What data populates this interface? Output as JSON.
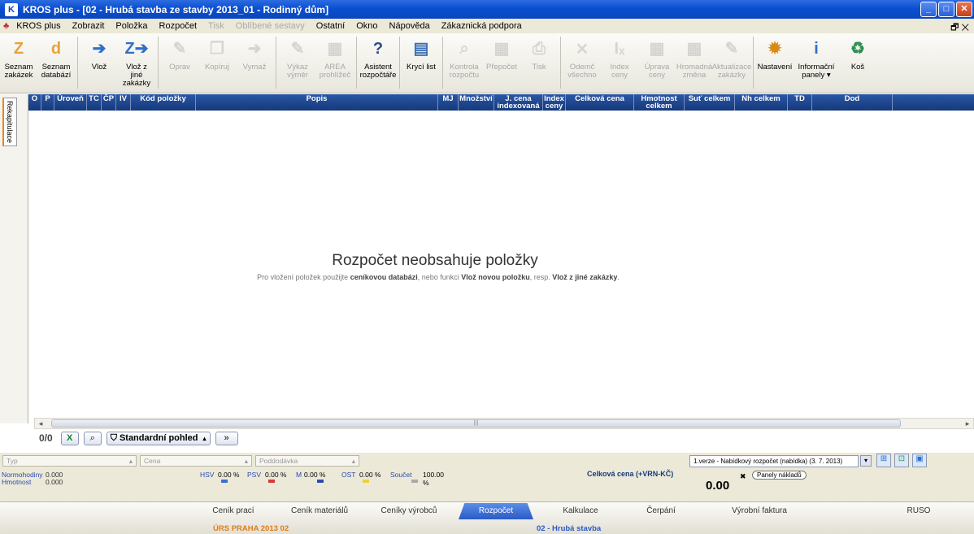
{
  "window": {
    "title": "KROS plus - [02 - Hrubá stavba ze stavby 2013_01 - Rodinný dům]",
    "app_icon": "K"
  },
  "menu": {
    "items": [
      {
        "label": "KROS plus",
        "disabled": false
      },
      {
        "label": "Zobrazit",
        "disabled": false
      },
      {
        "label": "Položka",
        "disabled": false
      },
      {
        "label": "Rozpočet",
        "disabled": false
      },
      {
        "label": "Tisk",
        "disabled": true
      },
      {
        "label": "Oblíbené sestavy",
        "disabled": true
      },
      {
        "label": "Ostatní",
        "disabled": false
      },
      {
        "label": "Okno",
        "disabled": false
      },
      {
        "label": "Nápověda",
        "disabled": false
      },
      {
        "label": "Zákaznická podpora",
        "disabled": false
      }
    ]
  },
  "toolbar": {
    "buttons": [
      {
        "label": "Seznam zakázek",
        "icon": "Z",
        "color": "#e8a13a",
        "disabled": false
      },
      {
        "label": "Seznam databází",
        "icon": "d",
        "color": "#e8a13a",
        "disabled": false
      },
      {
        "label": "Vlož",
        "icon": "➔",
        "color": "#2f6fc9",
        "disabled": false
      },
      {
        "label": "Vlož z jiné zakázky",
        "icon": "Z➔",
        "color": "#2f6fc9",
        "disabled": false
      },
      {
        "label": "Oprav",
        "icon": "✎",
        "color": "#999",
        "disabled": true
      },
      {
        "label": "Kopíruj",
        "icon": "❐",
        "color": "#999",
        "disabled": true
      },
      {
        "label": "Vymaž",
        "icon": "➜",
        "color": "#999",
        "disabled": true
      },
      {
        "label": "Výkaz výměr",
        "icon": "✎",
        "color": "#999",
        "disabled": true
      },
      {
        "label": "AREA prohlížeč",
        "icon": "▦",
        "color": "#999",
        "disabled": true
      },
      {
        "label": "Asistent rozpočtáře",
        "icon": "?",
        "color": "#2a4f86",
        "disabled": false
      },
      {
        "label": "Krycí list",
        "icon": "▤",
        "color": "#3b6fb6",
        "disabled": false
      },
      {
        "label": "Kontrola rozpočtu",
        "icon": "⌕",
        "color": "#999",
        "disabled": true
      },
      {
        "label": "Přepočet",
        "icon": "▦",
        "color": "#999",
        "disabled": true
      },
      {
        "label": "Tisk",
        "icon": "⎙",
        "color": "#999",
        "disabled": true
      },
      {
        "label": "Odemč všechno",
        "icon": "⨯",
        "color": "#999",
        "disabled": true
      },
      {
        "label": "Index ceny",
        "icon": "Iₓ",
        "color": "#999",
        "disabled": true
      },
      {
        "label": "Úprava ceny",
        "icon": "▦",
        "color": "#999",
        "disabled": true
      },
      {
        "label": "Hromadná změna",
        "icon": "▦",
        "color": "#999",
        "disabled": true
      },
      {
        "label": "Aktualizace zakázky",
        "icon": "✎",
        "color": "#999",
        "disabled": true
      },
      {
        "label": "Nastavení",
        "icon": "✹",
        "color": "#d98a14",
        "disabled": false
      },
      {
        "label": "Informační panely ▾",
        "icon": "i",
        "color": "#2f6fc9",
        "disabled": false
      },
      {
        "label": "Koš",
        "icon": "♻",
        "color": "#2f8f55",
        "disabled": false
      }
    ]
  },
  "grid": {
    "columns": [
      {
        "label": "O",
        "w": 16
      },
      {
        "label": "P",
        "w": 16
      },
      {
        "label": "Úroveň",
        "w": 40
      },
      {
        "label": "TC",
        "w": 18
      },
      {
        "label": "ČP",
        "w": 18
      },
      {
        "label": "IV",
        "w": 18
      },
      {
        "label": "Kód položky",
        "w": 80
      },
      {
        "label": "Popis",
        "w": 298
      },
      {
        "label": "MJ",
        "w": 25
      },
      {
        "label": "Množství",
        "w": 44
      },
      {
        "label": "J. cena indexovaná",
        "w": 60
      },
      {
        "label": "Index ceny",
        "w": 28
      },
      {
        "label": "Celková cena",
        "w": 84
      },
      {
        "label": "Hmotnost celkem",
        "w": 62
      },
      {
        "label": "Suť celkem",
        "w": 62
      },
      {
        "label": "Nh celkem",
        "w": 65
      },
      {
        "label": "TD",
        "w": 30
      },
      {
        "label": "Dod",
        "w": 99
      }
    ],
    "side_tab": "Rekapitulace",
    "empty_title": "Rozpočet neobsahuje položky",
    "empty_pre": "Pro vložení položek použijte ",
    "empty_b1": "ceníkovou databázi",
    "empty_mid": ", nebo funkci ",
    "empty_b2": "Vlož novou položku",
    "empty_mid2": ", resp. ",
    "empty_b3": "Vlož z jiné zakázky",
    "empty_end": "."
  },
  "nav": {
    "count": "0/0",
    "view_label": "Standardní pohled",
    "more": "»",
    "excel": "X"
  },
  "filters": {
    "tip": "Typ",
    "cena": "Cena",
    "poddodavka": "Poddodávka",
    "version": "1.verze - Nabídkový rozpočet (nabídka) (3. 7. 2013)"
  },
  "summary": {
    "normohodiny_label": "Normohodiny",
    "normohodiny": "0.000",
    "hmotnost_label": "Hmotnost",
    "hmotnost": "0.000",
    "shares": [
      {
        "label": "HSV",
        "value": "0.00 %",
        "color": "#3b6fd6"
      },
      {
        "label": "PSV",
        "value": "0.00 %",
        "color": "#d63b3b"
      },
      {
        "label": "M",
        "value": "0.00 %",
        "color": "#2a4bb0"
      },
      {
        "label": "OST",
        "value": "0.00 %",
        "color": "#e8d23b"
      },
      {
        "label": "Součet",
        "value": "100.00 %",
        "color": "#aaaaaa"
      }
    ],
    "celkova_label": "Celková cena (+VRN-KČ)",
    "celkova": "0.00",
    "panel_btn": "Panely nákladů"
  },
  "footer_tabs": [
    {
      "label": "Ceník prací",
      "active": false
    },
    {
      "label": "Ceník materiálů",
      "active": false
    },
    {
      "label": "Ceníky výrobců",
      "active": false
    },
    {
      "label": "Rozpočet",
      "active": true
    },
    {
      "label": "Kalkulace",
      "active": false
    },
    {
      "label": "Čerpání",
      "active": false
    },
    {
      "label": "Výrobní faktura",
      "active": false
    },
    {
      "label": "RUSO",
      "active": false
    }
  ],
  "footer_crumbs": {
    "left": "ÚRS PRAHA 2013 02",
    "right": "02 - Hrubá stavba"
  }
}
